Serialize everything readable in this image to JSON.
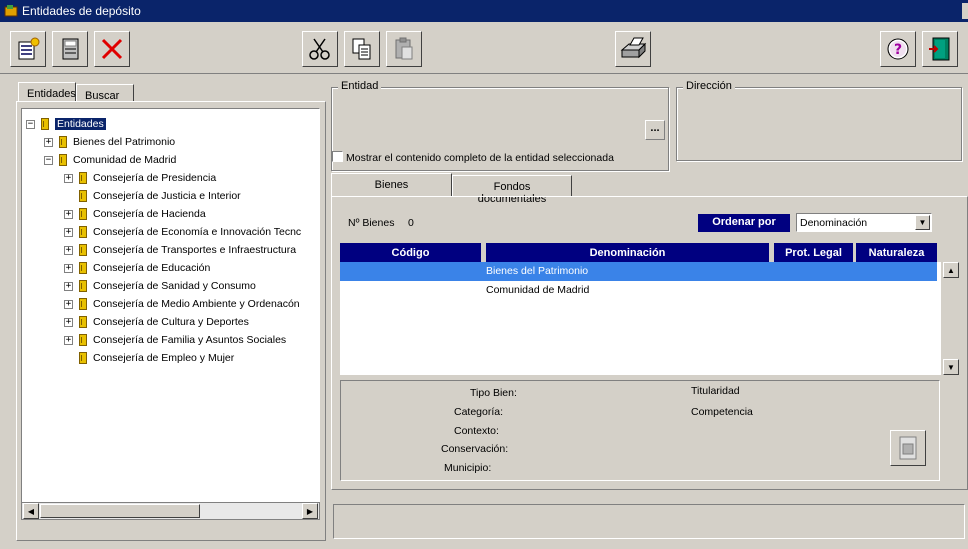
{
  "window": {
    "title": "Entidades de depósito"
  },
  "toolbar": {
    "buttons": [
      "new-document",
      "edit-document",
      "delete",
      "cut",
      "copy",
      "paste",
      "print",
      "help",
      "exit"
    ]
  },
  "left_tabs": [
    "Entidades",
    "Buscar"
  ],
  "tree": {
    "root": "Entidades",
    "level1": [
      "Bienes del Patrimonio",
      "Comunidad de Madrid"
    ],
    "children": [
      "Consejería de Presidencia",
      "Consejería de Justicia e Interior",
      "Consejería de Hacienda",
      "Consejería de Economía e Innovación Tecnc",
      "Consejería de Transportes e Infraestructura",
      "Consejería de Educación",
      "Consejería de Sanidad y Consumo",
      "Consejería de Medio Ambiente y Ordenacón",
      "Consejería de Cultura y Deportes",
      "Consejería de Familia y Asuntos Sociales",
      "Consejería de Empleo y Mujer"
    ]
  },
  "entidad": {
    "label": "Entidad",
    "browse": "..."
  },
  "direccion": {
    "label": "Dirección"
  },
  "mostrar_checkbox": {
    "label": "Mostrar el contenido completo de la entidad seleccionada",
    "checked": false
  },
  "right_tabs": [
    "Bienes",
    "Fondos documentales"
  ],
  "bienes": {
    "count_label": "Nº Bienes",
    "count_value": "0",
    "order_label": "Ordenar por",
    "order_value": "Denominación",
    "columns": [
      "Código",
      "Denominación",
      "Prot. Legal",
      "Naturaleza"
    ],
    "rows": [
      {
        "codigo": "",
        "denominacion": "Bienes del Patrimonio",
        "prot": "",
        "nat": ""
      },
      {
        "codigo": "",
        "denominacion": "Comunidad de Madrid",
        "prot": "",
        "nat": ""
      }
    ]
  },
  "detail": {
    "tipo_bien": "Tipo Bien:",
    "categoria": "Categoría:",
    "contexto": "Contexto:",
    "conservacion": "Conservación:",
    "municipio": "Municipio:",
    "titularidad": "Titularidad",
    "competencia": "Competencia"
  },
  "colors": {
    "selection": "#3a83e8",
    "header": "#000080",
    "titlebar": "#0a246a"
  }
}
